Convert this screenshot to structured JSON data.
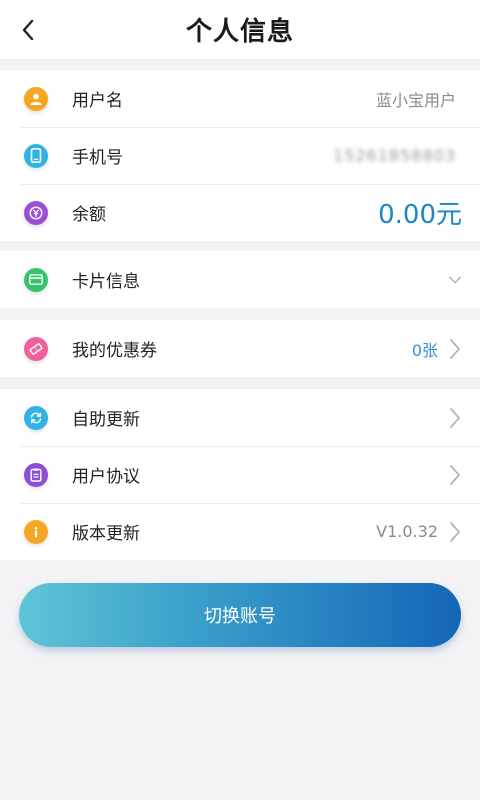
{
  "header": {
    "title": "个人信息"
  },
  "icons": {
    "back": "chevron-left-icon"
  },
  "account": {
    "rows": [
      {
        "label": "用户名",
        "value": "蓝小宝用户",
        "icon": "user-icon",
        "color": "#f5a623"
      },
      {
        "label": "手机号",
        "value": "15261858803",
        "icon": "phone-icon",
        "color": "#2fb4e6"
      },
      {
        "label": "余额",
        "value": "0.00元",
        "icon": "yen-icon",
        "color": "#9b4fd6"
      }
    ]
  },
  "card": {
    "label": "卡片信息",
    "icon": "card-icon",
    "color": "#34c46b"
  },
  "coupon": {
    "label": "我的优惠券",
    "value": "0张",
    "icon": "ticket-icon",
    "color": "#f0609a"
  },
  "settings": {
    "rows": [
      {
        "label": "自助更新",
        "value": "",
        "icon": "refresh-icon",
        "color": "#2fb4e6"
      },
      {
        "label": "用户协议",
        "value": "",
        "icon": "document-icon",
        "color": "#8a4fd6"
      },
      {
        "label": "版本更新",
        "value": "V1.0.32",
        "icon": "info-icon",
        "color": "#f5a623"
      }
    ]
  },
  "actions": {
    "switch_account": "切换账号"
  },
  "colors": {
    "accent_balance": "#1b86c8",
    "button_gradient_start": "#5ec5d7",
    "button_gradient_end": "#1366b7"
  }
}
